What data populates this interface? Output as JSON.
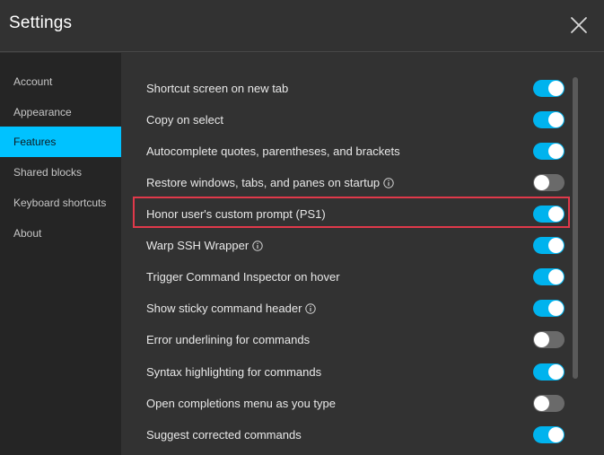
{
  "header": {
    "title": "Settings"
  },
  "sidebar": {
    "items": [
      {
        "label": "Account",
        "active": false
      },
      {
        "label": "Appearance",
        "active": false
      },
      {
        "label": "Features",
        "active": true
      },
      {
        "label": "Shared blocks",
        "active": false
      },
      {
        "label": "Keyboard shortcuts",
        "active": false
      },
      {
        "label": "About",
        "active": false
      }
    ]
  },
  "features": [
    {
      "label": "Shortcut screen on new tab",
      "enabled": true,
      "info": false
    },
    {
      "label": "Copy on select",
      "enabled": true,
      "info": false
    },
    {
      "label": "Autocomplete quotes, parentheses, and brackets",
      "enabled": true,
      "info": false
    },
    {
      "label": "Restore windows, tabs, and panes on startup",
      "enabled": false,
      "info": true
    },
    {
      "label": "Honor user's custom prompt (PS1)",
      "enabled": true,
      "info": false,
      "highlighted": true
    },
    {
      "label": "Warp SSH Wrapper",
      "enabled": true,
      "info": true
    },
    {
      "label": "Trigger Command Inspector on hover",
      "enabled": true,
      "info": false
    },
    {
      "label": "Show sticky command header",
      "enabled": true,
      "info": true
    },
    {
      "label": "Error underlining for commands",
      "enabled": false,
      "info": false
    },
    {
      "label": "Syntax highlighting for commands",
      "enabled": true,
      "info": false
    },
    {
      "label": "Open completions menu as you type",
      "enabled": false,
      "info": false
    },
    {
      "label": "Suggest corrected commands",
      "enabled": true,
      "info": false
    }
  ],
  "colors": {
    "accent": "#00c2ff",
    "toggle_on": "#00b3ee",
    "toggle_off": "#6a6a6a",
    "highlight_border": "#e0394a",
    "background": "#323232",
    "sidebar_background": "#252525"
  },
  "icons": {
    "close": "close-icon",
    "info": "info-icon"
  }
}
